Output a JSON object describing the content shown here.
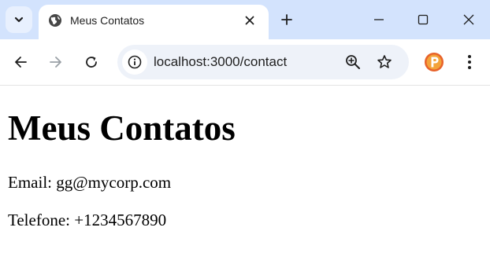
{
  "browser": {
    "tab": {
      "title": "Meus Contatos",
      "icon": "globe-icon"
    },
    "address": "localhost:3000/contact",
    "colors": {
      "tabbar": "#d3e3fd",
      "omnibox": "#eef2f9",
      "extension": "#e8622a"
    }
  },
  "page": {
    "heading": "Meus Contatos",
    "email_line": "Email: gg@mycorp.com",
    "phone_line": "Telefone: +1234567890"
  }
}
